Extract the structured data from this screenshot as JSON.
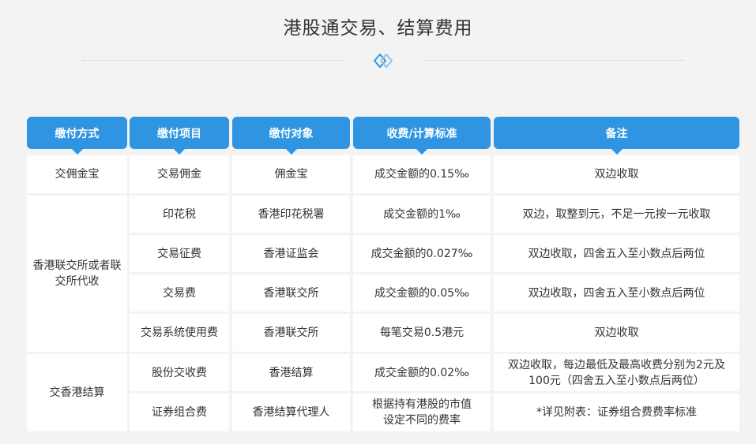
{
  "title": "港股通交易、结算费用",
  "headers": [
    "缴付方式",
    "缴付项目",
    "缴付对象",
    "收费/计算标准",
    "备注"
  ],
  "groups": [
    {
      "label": "交佣金宝"
    },
    {
      "label": "香港联交所或者联交所代收"
    },
    {
      "label": "交香港结算"
    }
  ],
  "rows": [
    {
      "item": "交易佣金",
      "payee": "佣金宝",
      "standard": "成交金额的0.15‰",
      "note": "双边收取"
    },
    {
      "item": "印花税",
      "payee": "香港印花税署",
      "standard": "成交金额的1‰",
      "note": "双边，取整到元，不足一元按一元收取"
    },
    {
      "item": "交易征费",
      "payee": "香港证监会",
      "standard": "成交金额的0.027‰",
      "note": "双边收取，四舍五入至小数点后两位"
    },
    {
      "item": "交易费",
      "payee": "香港联交所",
      "standard": "成交金额的0.05‰",
      "note": "双边收取，四舍五入至小数点后两位"
    },
    {
      "item": "交易系统使用费",
      "payee": "香港联交所",
      "standard": "每笔交易0.5港元",
      "note": "双边收取"
    },
    {
      "item": "股份交收费",
      "payee": "香港结算",
      "standard": "成交金额的0.02‰",
      "note": "双边收取，每边最低及最高收费分别为2元及100元（四舍五入至小数点后两位）"
    },
    {
      "item": "证券组合费",
      "payee": "香港结算代理人",
      "standard": "根据持有港股的市值设定不同的费率",
      "note": "*详见附表：证券组合费费率标准"
    }
  ],
  "colors": {
    "header": "#2f95e3",
    "background": "#f3f3f3",
    "cell": "#ffffff"
  },
  "icons": {
    "divider": "diamond-link-icon"
  }
}
